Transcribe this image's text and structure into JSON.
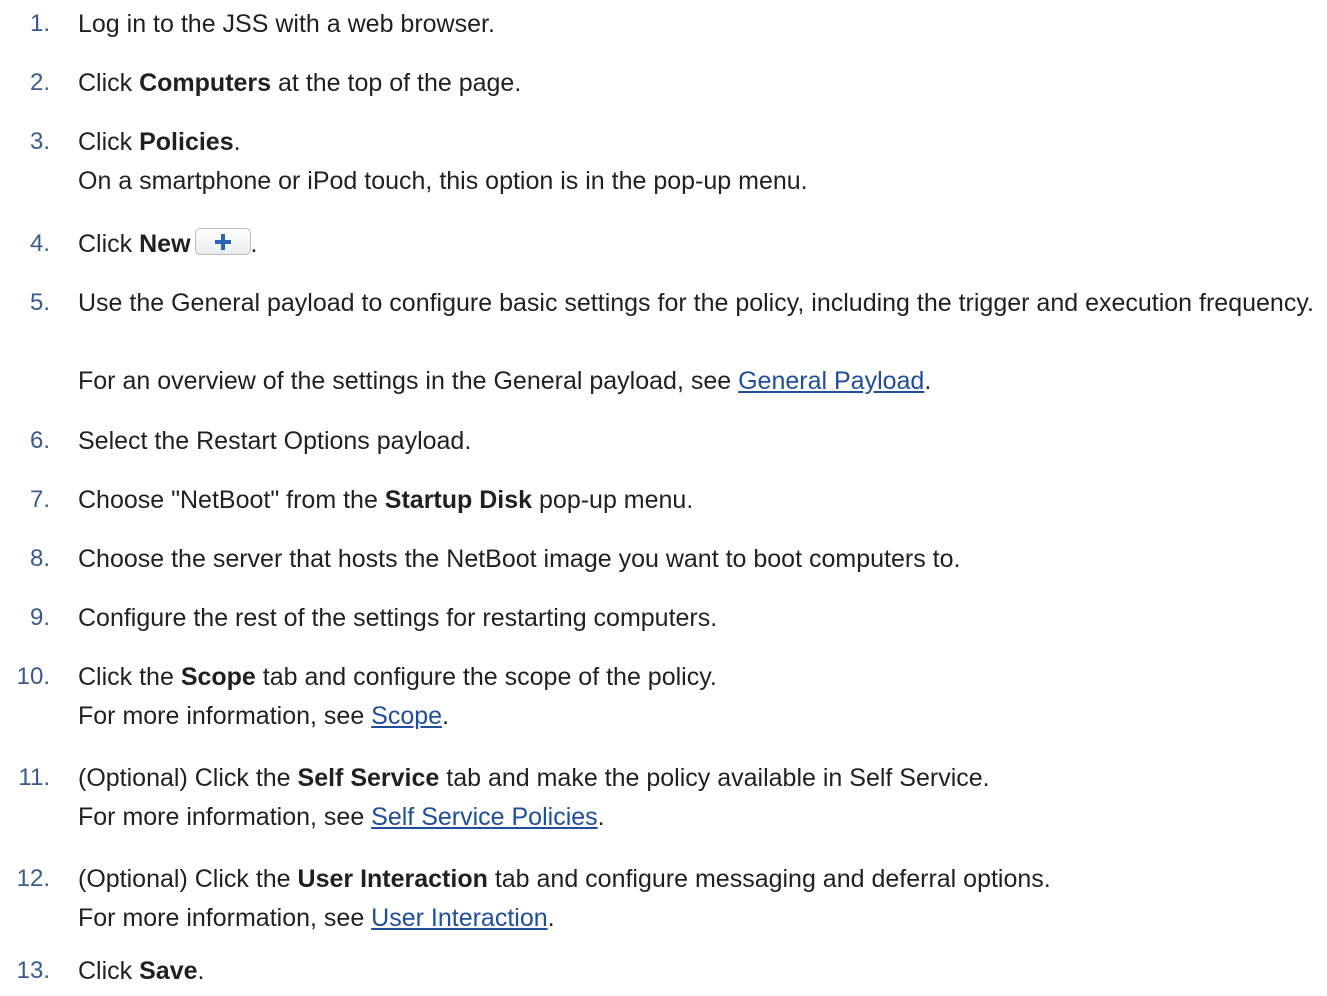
{
  "steps": [
    {
      "num": "1.",
      "pre": "Log in to the JSS with a web browser."
    },
    {
      "num": "2.",
      "pre": "Click ",
      "bold": "Computers",
      "post": " at the top of the page."
    },
    {
      "num": "3.",
      "pre": "Click ",
      "bold": "Policies",
      "post": ".",
      "note": "On a smartphone or iPod touch, this option is in the pop-up menu."
    },
    {
      "num": "4.",
      "pre": "Click ",
      "bold": "New",
      "post": "."
    },
    {
      "num": "5.",
      "pre": "Use the General payload to configure basic settings for the policy, including the trigger and execution frequency.",
      "note_pre": "For an overview of the settings in the General payload, see ",
      "note_link": "General Payload",
      "note_post": "."
    },
    {
      "num": "6.",
      "pre": "Select the Restart Options payload."
    },
    {
      "num": "7.",
      "pre": "Choose \"NetBoot\" from the ",
      "bold": "Startup Disk",
      "post": " pop-up menu."
    },
    {
      "num": "8.",
      "pre": "Choose the server that hosts the NetBoot image you want to boot computers to."
    },
    {
      "num": "9.",
      "pre": "Configure the rest of the settings for restarting computers."
    },
    {
      "num": "10.",
      "pre": "Click the ",
      "bold": "Scope",
      "post": " tab and configure the scope of the policy.",
      "note_pre": "For more information, see ",
      "note_link": "Scope",
      "note_post": "."
    },
    {
      "num": "11.",
      "pre": "(Optional) Click the ",
      "bold": "Self Service",
      "post": " tab and make the policy available in Self Service.",
      "note_pre": "For more information, see ",
      "note_link": "Self Service Policies",
      "note_post": "."
    },
    {
      "num": "12.",
      "pre": "(Optional) Click the ",
      "bold": "User Interaction",
      "post": " tab and configure messaging and deferral options.",
      "note_pre": "For more information, see ",
      "note_link": "User Interaction",
      "note_post": "."
    },
    {
      "num": "13.",
      "pre": "Click ",
      "bold": "Save",
      "post": "."
    }
  ],
  "icons": {
    "new_button": "plus-icon"
  },
  "colors": {
    "text": "#231f20",
    "number": "#3a5a8c",
    "link": "#1f4e9a",
    "plus": "#2b63b5"
  }
}
